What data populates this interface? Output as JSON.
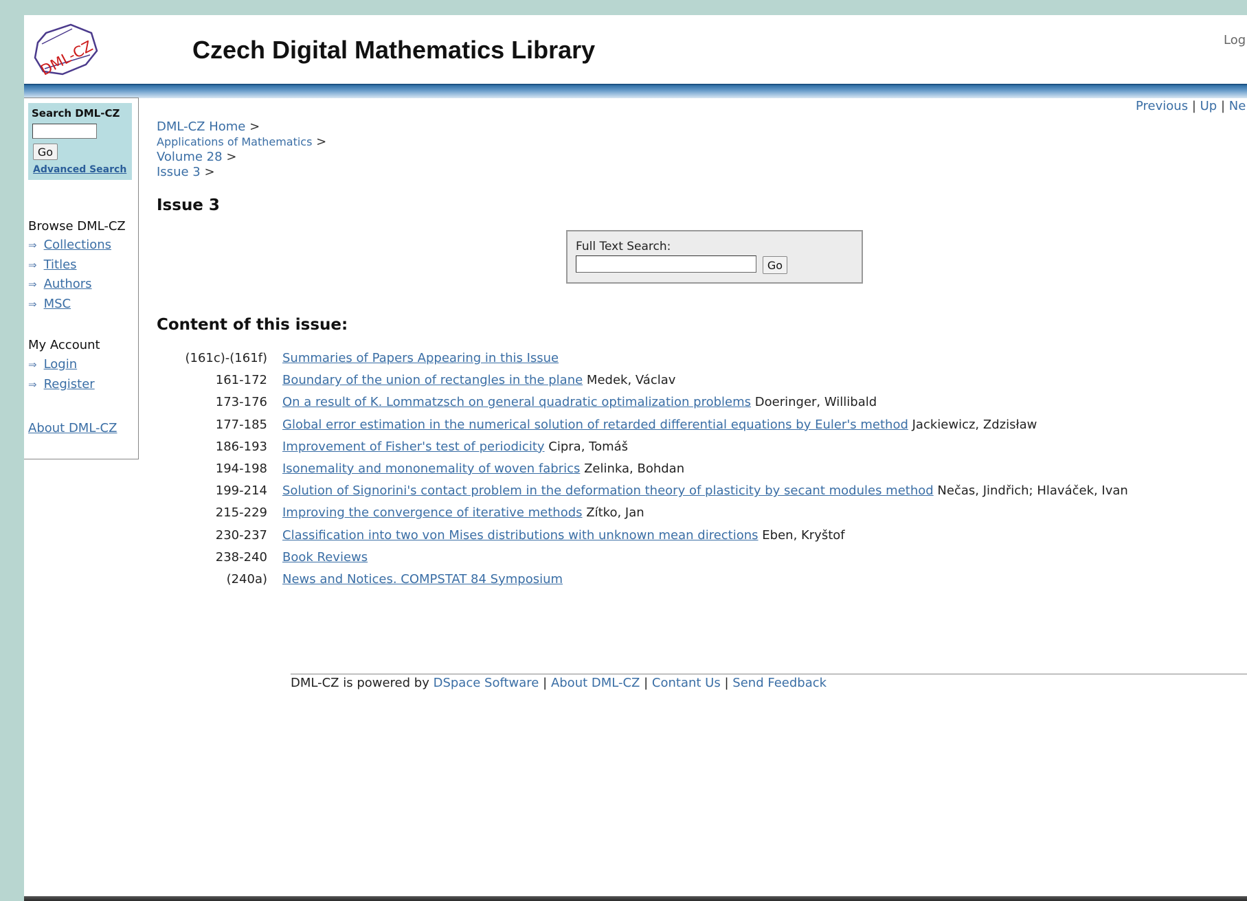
{
  "header": {
    "logo_text": "DML-CZ",
    "title": "Czech Digital Mathematics Library",
    "login_label": "Log"
  },
  "sidebar": {
    "search_title": "Search DML-CZ",
    "search_input_value": "",
    "go_label": "Go",
    "advanced_search_label": "Advanced Search",
    "browse_heading": "Browse DML-CZ",
    "browse_items": [
      "Collections",
      "Titles",
      "Authors",
      "MSC"
    ],
    "account_heading": "My Account",
    "account_items": [
      "Login",
      "Register"
    ],
    "about_label": "About DML-CZ"
  },
  "nav": {
    "previous": "Previous",
    "up": "Up",
    "next": "Ne"
  },
  "breadcrumb": {
    "home": "DML-CZ Home",
    "journal": "Applications of Mathematics",
    "volume": "Volume 28",
    "issue": "Issue 3",
    "separator": ">"
  },
  "page_title": "Issue 3",
  "full_text_search": {
    "label": "Full Text Search:",
    "value": "",
    "go_label": "Go"
  },
  "contents_heading": "Content of this issue:",
  "contents": [
    {
      "pages": "(161c)-(161f)",
      "title": "Summaries of Papers Appearing in this Issue",
      "authors": ""
    },
    {
      "pages": "161-172",
      "title": "Boundary of the union of rectangles in the plane",
      "authors": "Medek, Václav"
    },
    {
      "pages": "173-176",
      "title": "On a result of K. Lommatzsch on general quadratic optimalization problems",
      "authors": "Doeringer, Willibald"
    },
    {
      "pages": "177-185",
      "title": "Global error estimation in the numerical solution of retarded differential equations by Euler's method",
      "authors": "Jackiewicz, Zdzisław"
    },
    {
      "pages": "186-193",
      "title": "Improvement of Fisher's test of periodicity",
      "authors": "Cipra, Tomáš"
    },
    {
      "pages": "194-198",
      "title": "Isonemality and mononemality of woven fabrics",
      "authors": "Zelinka, Bohdan"
    },
    {
      "pages": "199-214",
      "title": "Solution of Signorini's contact problem in the deformation theory of plasticity by secant modules method",
      "authors": "Nečas, Jindřich; Hlaváček, Ivan"
    },
    {
      "pages": "215-229",
      "title": "Improving the convergence of iterative methods",
      "authors": "Zítko, Jan"
    },
    {
      "pages": "230-237",
      "title": "Classification into two von Mises distributions with unknown mean directions",
      "authors": "Eben, Kryštof"
    },
    {
      "pages": "238-240",
      "title": "Book Reviews",
      "authors": ""
    },
    {
      "pages": "(240a)",
      "title": "News and Notices. COMPSTAT 84 Symposium",
      "authors": ""
    }
  ],
  "footer": {
    "powered_by": "DML-CZ is powered by",
    "dspace": "DSpace Software",
    "about": "About DML-CZ",
    "contact": "Contant Us",
    "feedback": "Send Feedback",
    "sep": "|"
  },
  "colors": {
    "link": "#3a6ea5",
    "logo_red": "#cc1a1a",
    "logo_purple": "#4b3a8c",
    "search_box_bg": "#b8dde1",
    "header_bar": "#2e6ea4",
    "outer_bg": "#b8d6d0"
  }
}
